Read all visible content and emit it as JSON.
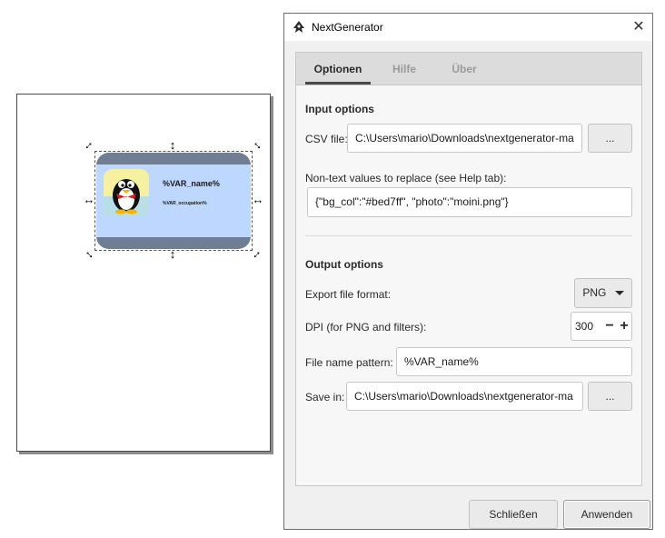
{
  "canvas": {
    "card": {
      "name_text": "%VAR_name%",
      "occupation_text": "%VAR_occupation%"
    }
  },
  "window": {
    "title": "NextGenerator",
    "close_glyph": "✕"
  },
  "tabs": [
    {
      "label": "Optionen",
      "active": true
    },
    {
      "label": "Hilfe",
      "active": false
    },
    {
      "label": "Über",
      "active": false
    }
  ],
  "input_options": {
    "heading": "Input options",
    "csv_label": "CSV file:",
    "csv_value": "C:\\Users\\mario\\Downloads\\nextgenerator-ma",
    "browse_label": "...",
    "nontext_label": "Non-text values to replace (see Help tab):",
    "nontext_value": "{\"bg_col\":\"#bed7ff\", \"photo\":\"moini.png\"}"
  },
  "output_options": {
    "heading": "Output options",
    "format_label": "Export file format:",
    "format_value": "PNG",
    "dpi_label": "DPI (for PNG and filters):",
    "dpi_value": "300",
    "dpi_minus": "−",
    "dpi_plus": "+",
    "pattern_label": "File name pattern:",
    "pattern_value": "%VAR_name%",
    "save_label": "Save in:",
    "save_value": "C:\\Users\\mario\\Downloads\\nextgenerator-ma",
    "browse_label": "..."
  },
  "footer": {
    "close_label": "Schließen",
    "apply_label": "Anwenden"
  },
  "colors": {
    "card_bg": "#bed7ff",
    "card_band": "#707e93"
  }
}
